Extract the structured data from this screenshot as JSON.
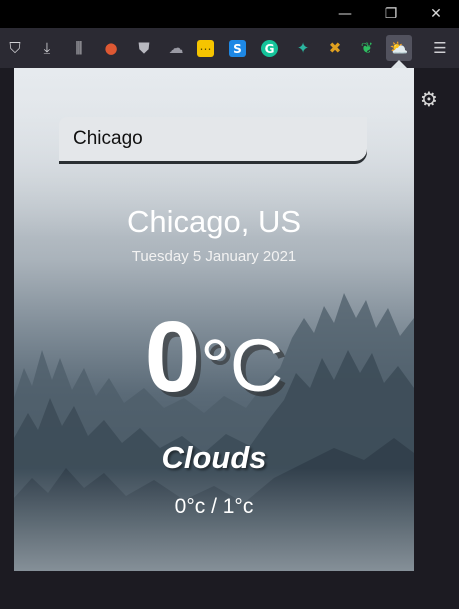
{
  "window": {
    "minimize_glyph": "—",
    "restore_glyph": "❐",
    "close_glyph": "✕"
  },
  "toolbar": {
    "icons": [
      {
        "name": "pocket-icon",
        "glyph": "⛉"
      },
      {
        "name": "download-icon",
        "glyph": "⤓"
      },
      {
        "name": "library-icon",
        "glyph": "⫼"
      },
      {
        "name": "duckduckgo-icon",
        "glyph": "●"
      },
      {
        "name": "ublock-icon",
        "glyph": "⛊"
      },
      {
        "name": "cloud-extension-icon",
        "glyph": "☁"
      },
      {
        "name": "dots-extension-icon",
        "glyph": "⋯"
      },
      {
        "name": "s-extension-icon",
        "glyph": "S"
      },
      {
        "name": "grammarly-icon",
        "glyph": "G"
      },
      {
        "name": "bird-extension-icon",
        "glyph": "✦"
      },
      {
        "name": "tools-extension-icon",
        "glyph": "✖"
      },
      {
        "name": "evernote-icon",
        "glyph": "❦"
      },
      {
        "name": "weather-extension-icon",
        "glyph": "⛅"
      },
      {
        "name": "menu-icon",
        "glyph": "☰"
      }
    ],
    "colors": {
      "duckduckgo": "#de5833",
      "dots": "#f5c400",
      "s": "#1e88e5",
      "grammarly": "#15c39a",
      "bird": "#2bb5a0",
      "tools": "#e0a020",
      "evernote": "#2dbe60"
    }
  },
  "settings": {
    "glyph": "⚙"
  },
  "weather": {
    "search_value": "Chicago",
    "location": "Chicago, US",
    "date": "Tuesday 5 January 2021",
    "temperature": "0",
    "unit": "°C",
    "condition": "Clouds",
    "range": "0°c / 1°c"
  }
}
